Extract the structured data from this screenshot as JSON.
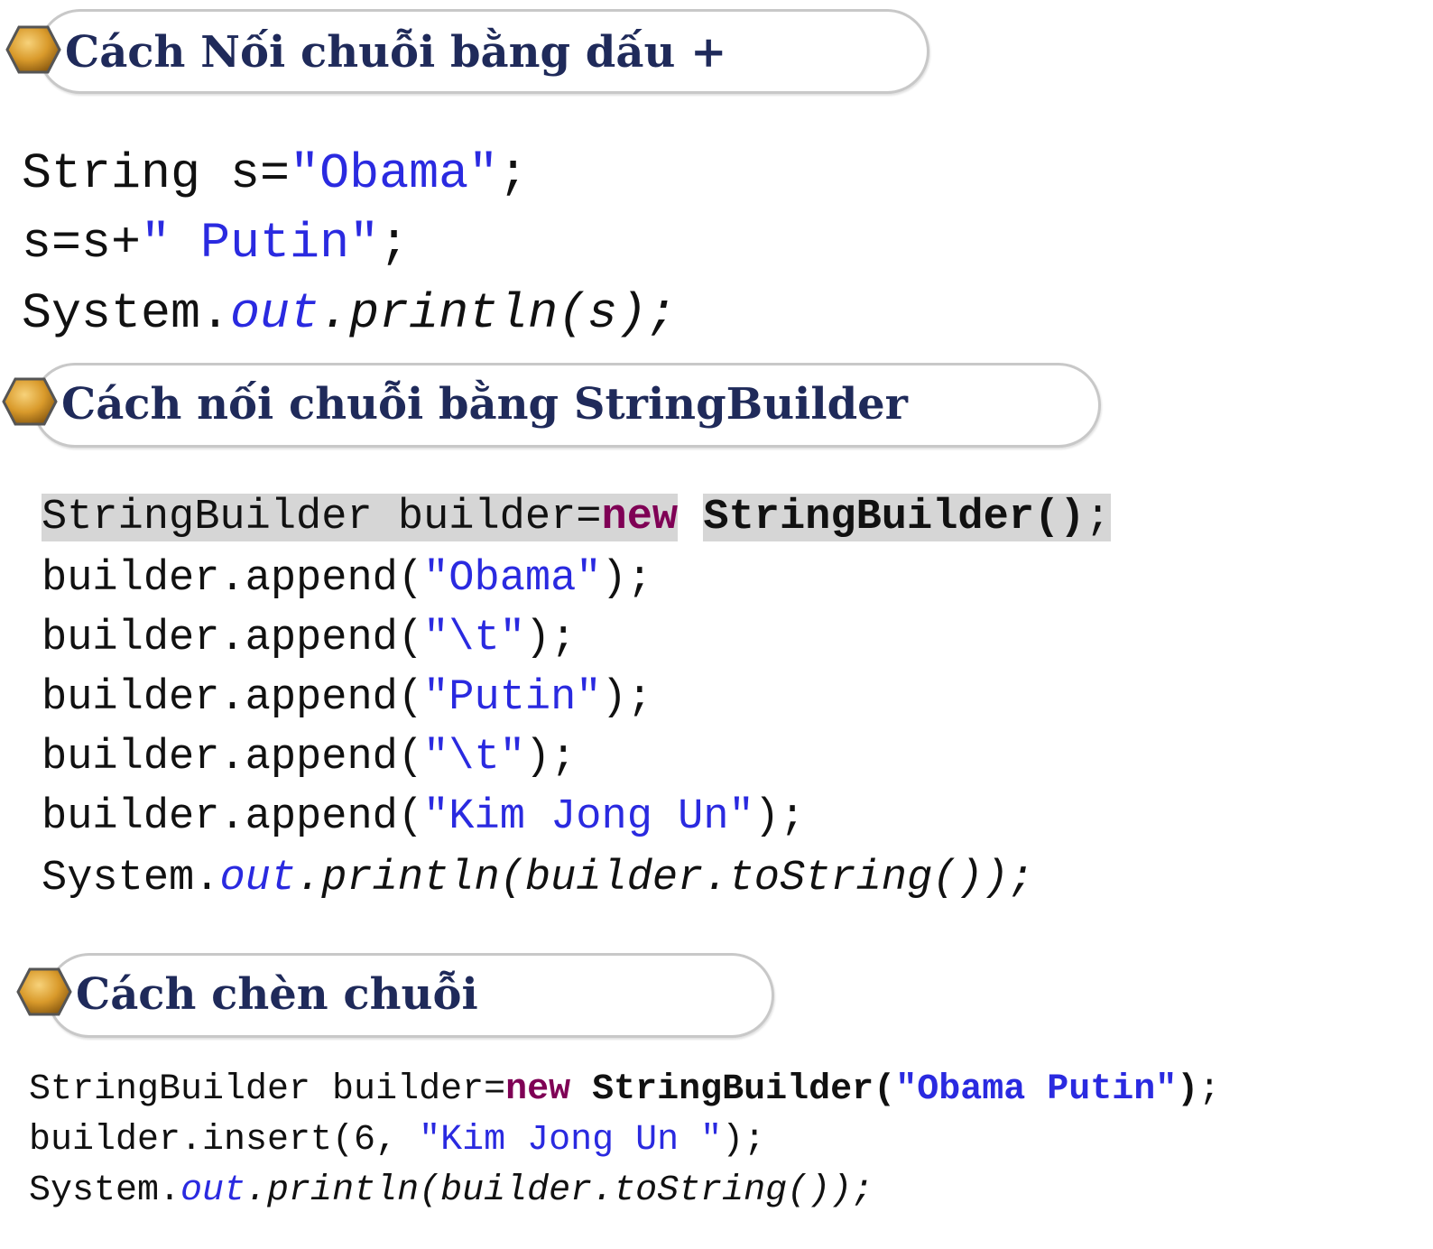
{
  "section1": {
    "title": "Cách Nối chuỗi bằng dấu +",
    "code": {
      "l1_a": "String s=",
      "l1_str": "\"Obama\"",
      "l1_end": ";",
      "l2_a": "s=s+",
      "l2_str": "\" Putin\"",
      "l2_end": ";",
      "l3_a": "System.",
      "l3_out": "out",
      "l3_b": ".println(s);"
    }
  },
  "section2": {
    "title": "Cách nối chuỗi bằng StringBuilder",
    "code": {
      "l1_a": "StringBuilder builder=",
      "l1_kw": "new",
      "l1_b": "StringBuilder()",
      "l1_end": ";",
      "l2_a": "builder.append(",
      "l2_str": "\"Obama\"",
      "l2_end": ");",
      "l3_a": "builder.append(",
      "l3_str": "\"\\t\"",
      "l3_end": ");",
      "l4_a": "builder.append(",
      "l4_str": "\"Putin\"",
      "l4_end": ");",
      "l5_a": "builder.append(",
      "l5_str": "\"\\t\"",
      "l5_end": ");",
      "l6_a": "builder.append(",
      "l6_str": "\"Kim Jong Un\"",
      "l6_end": ");",
      "l7_a": "System.",
      "l7_out": "out",
      "l7_b": ".println(builder.toString());"
    }
  },
  "section3": {
    "title": "Cách chèn chuỗi",
    "code": {
      "l1_a": "StringBuilder builder=",
      "l1_kw": "new",
      "l1_b": "StringBuilder(",
      "l1_str": "\"Obama Putin\"",
      "l1_c": ")",
      "l1_end": ";",
      "l2_a": "builder.insert(6, ",
      "l2_str": "\"Kim Jong Un \"",
      "l2_end": ");",
      "l3_a": "System.",
      "l3_out": "out",
      "l3_b": ".println(builder.toString());"
    }
  },
  "colors": {
    "heading": "#1f2a5a",
    "string_literal": "#2a2ae0",
    "keyword": "#7f0055",
    "highlight": "#d6d6d6",
    "pill_border": "#c8c8c8",
    "hex_fill": "#e0a030"
  },
  "icons": {
    "bullet": "hexagon-bullet-icon"
  }
}
